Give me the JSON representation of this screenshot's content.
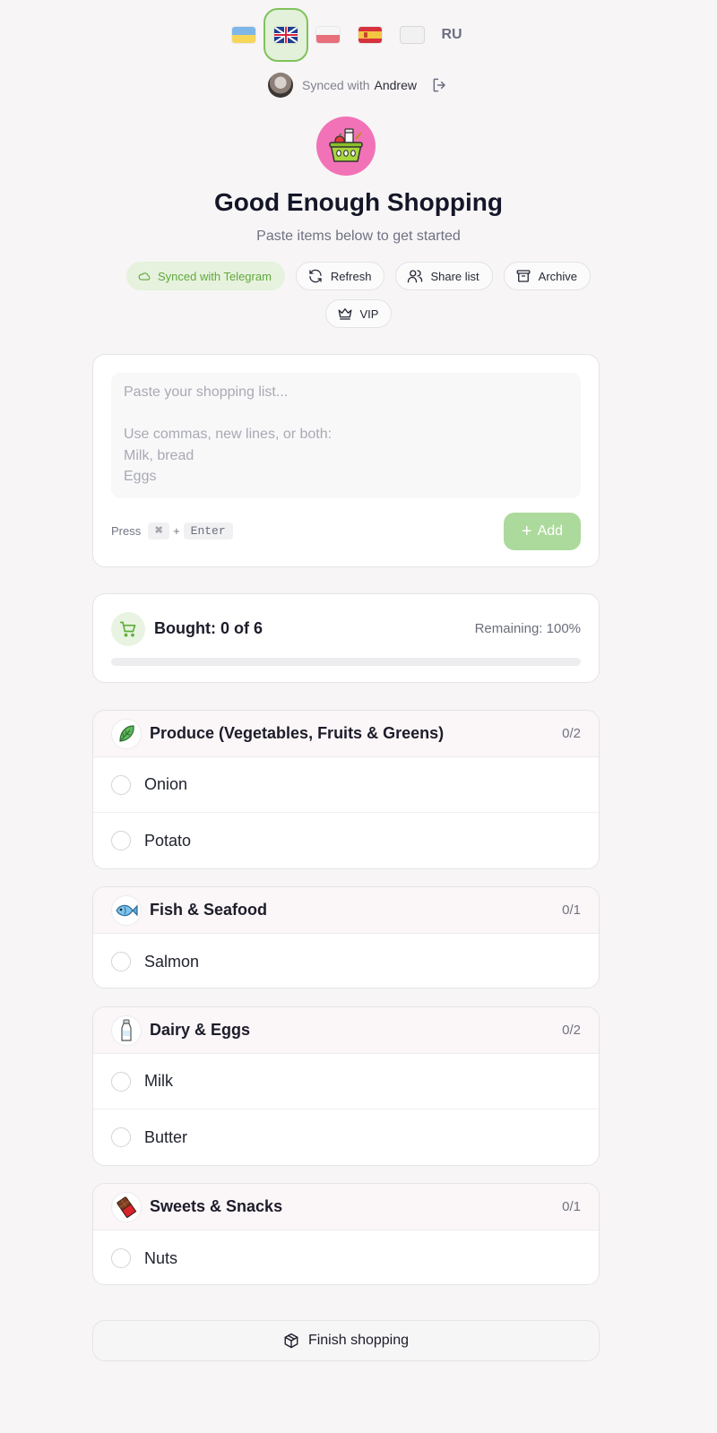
{
  "languages": [
    {
      "code": "ua",
      "icon": "ukraine-flag-icon"
    },
    {
      "code": "gb",
      "icon": "uk-flag-icon",
      "active": true
    },
    {
      "code": "pl",
      "icon": "poland-flag-icon"
    },
    {
      "code": "es",
      "icon": "spain-flag-icon"
    },
    {
      "code": "white",
      "icon": "white-flag-icon"
    },
    {
      "code": "ru",
      "label": "RU"
    }
  ],
  "sync": {
    "text": "Synced with",
    "name": "Andrew",
    "logout_icon": "logout-icon"
  },
  "app": {
    "logo_icon": "shopping-basket-icon",
    "title": "Good Enough Shopping",
    "subtitle": "Paste items below to get started"
  },
  "actions": {
    "synced_telegram": "Synced with Telegram",
    "refresh": "Refresh",
    "share_list": "Share list",
    "archive": "Archive",
    "vip": "VIP"
  },
  "input": {
    "placeholder": "Paste your shopping list...\n\nUse commas, new lines, or both:\nMilk, bread\nEggs",
    "value": "",
    "hint_press": "Press",
    "hint_key1": "⌘",
    "hint_plus": "+",
    "hint_key2": "Enter",
    "add_label": "Add"
  },
  "progress": {
    "bought_label": "Bought: 0 of 6",
    "remaining_label": "Remaining: 100%",
    "bought_fraction": 0.0
  },
  "categories": [
    {
      "name": "Produce (Vegetables, Fruits & Greens)",
      "count": "0/2",
      "icon": "leafy-greens-icon",
      "items": [
        "Onion",
        "Potato"
      ]
    },
    {
      "name": "Fish & Seafood",
      "count": "0/1",
      "icon": "fish-icon",
      "items": [
        "Salmon"
      ]
    },
    {
      "name": "Dairy & Eggs",
      "count": "0/2",
      "icon": "milk-bottle-icon",
      "items": [
        "Milk",
        "Butter"
      ]
    },
    {
      "name": "Sweets & Snacks",
      "count": "0/1",
      "icon": "chocolate-bar-icon",
      "items": [
        "Nuts"
      ]
    }
  ],
  "finish": {
    "label": "Finish shopping",
    "icon": "package-icon"
  },
  "colors": {
    "accent_green": "#7fc25a",
    "add_button": "#acd99c",
    "logo_pink": "#f272b7",
    "background": "#f7f5f6"
  }
}
